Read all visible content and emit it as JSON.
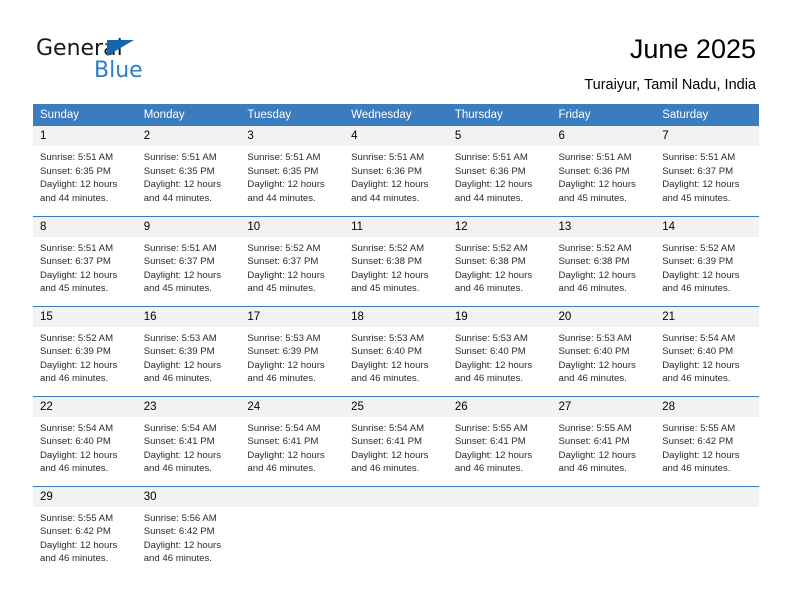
{
  "brand": {
    "name_top": "General",
    "name_bottom": "Blue",
    "triangle_color": "#1565b0",
    "text_color": "#1a1a1a",
    "blue_color": "#2a7fc9"
  },
  "header": {
    "title": "June 2025",
    "subtitle": "Turaiyur, Tamil Nadu, India"
  },
  "theme": {
    "header_bg": "#3a7cbe",
    "header_text": "#ffffff",
    "daynum_bg": "#f2f2f2",
    "row_divider": "#3a7cbe",
    "body_text": "#2b2b2b"
  },
  "columns": [
    "Sunday",
    "Monday",
    "Tuesday",
    "Wednesday",
    "Thursday",
    "Friday",
    "Saturday"
  ],
  "weeks": [
    [
      {
        "day": "1",
        "sunrise": "Sunrise: 5:51 AM",
        "sunset": "Sunset: 6:35 PM",
        "daylight1": "Daylight: 12 hours",
        "daylight2": "and 44 minutes."
      },
      {
        "day": "2",
        "sunrise": "Sunrise: 5:51 AM",
        "sunset": "Sunset: 6:35 PM",
        "daylight1": "Daylight: 12 hours",
        "daylight2": "and 44 minutes."
      },
      {
        "day": "3",
        "sunrise": "Sunrise: 5:51 AM",
        "sunset": "Sunset: 6:35 PM",
        "daylight1": "Daylight: 12 hours",
        "daylight2": "and 44 minutes."
      },
      {
        "day": "4",
        "sunrise": "Sunrise: 5:51 AM",
        "sunset": "Sunset: 6:36 PM",
        "daylight1": "Daylight: 12 hours",
        "daylight2": "and 44 minutes."
      },
      {
        "day": "5",
        "sunrise": "Sunrise: 5:51 AM",
        "sunset": "Sunset: 6:36 PM",
        "daylight1": "Daylight: 12 hours",
        "daylight2": "and 44 minutes."
      },
      {
        "day": "6",
        "sunrise": "Sunrise: 5:51 AM",
        "sunset": "Sunset: 6:36 PM",
        "daylight1": "Daylight: 12 hours",
        "daylight2": "and 45 minutes."
      },
      {
        "day": "7",
        "sunrise": "Sunrise: 5:51 AM",
        "sunset": "Sunset: 6:37 PM",
        "daylight1": "Daylight: 12 hours",
        "daylight2": "and 45 minutes."
      }
    ],
    [
      {
        "day": "8",
        "sunrise": "Sunrise: 5:51 AM",
        "sunset": "Sunset: 6:37 PM",
        "daylight1": "Daylight: 12 hours",
        "daylight2": "and 45 minutes."
      },
      {
        "day": "9",
        "sunrise": "Sunrise: 5:51 AM",
        "sunset": "Sunset: 6:37 PM",
        "daylight1": "Daylight: 12 hours",
        "daylight2": "and 45 minutes."
      },
      {
        "day": "10",
        "sunrise": "Sunrise: 5:52 AM",
        "sunset": "Sunset: 6:37 PM",
        "daylight1": "Daylight: 12 hours",
        "daylight2": "and 45 minutes."
      },
      {
        "day": "11",
        "sunrise": "Sunrise: 5:52 AM",
        "sunset": "Sunset: 6:38 PM",
        "daylight1": "Daylight: 12 hours",
        "daylight2": "and 45 minutes."
      },
      {
        "day": "12",
        "sunrise": "Sunrise: 5:52 AM",
        "sunset": "Sunset: 6:38 PM",
        "daylight1": "Daylight: 12 hours",
        "daylight2": "and 46 minutes."
      },
      {
        "day": "13",
        "sunrise": "Sunrise: 5:52 AM",
        "sunset": "Sunset: 6:38 PM",
        "daylight1": "Daylight: 12 hours",
        "daylight2": "and 46 minutes."
      },
      {
        "day": "14",
        "sunrise": "Sunrise: 5:52 AM",
        "sunset": "Sunset: 6:39 PM",
        "daylight1": "Daylight: 12 hours",
        "daylight2": "and 46 minutes."
      }
    ],
    [
      {
        "day": "15",
        "sunrise": "Sunrise: 5:52 AM",
        "sunset": "Sunset: 6:39 PM",
        "daylight1": "Daylight: 12 hours",
        "daylight2": "and 46 minutes."
      },
      {
        "day": "16",
        "sunrise": "Sunrise: 5:53 AM",
        "sunset": "Sunset: 6:39 PM",
        "daylight1": "Daylight: 12 hours",
        "daylight2": "and 46 minutes."
      },
      {
        "day": "17",
        "sunrise": "Sunrise: 5:53 AM",
        "sunset": "Sunset: 6:39 PM",
        "daylight1": "Daylight: 12 hours",
        "daylight2": "and 46 minutes."
      },
      {
        "day": "18",
        "sunrise": "Sunrise: 5:53 AM",
        "sunset": "Sunset: 6:40 PM",
        "daylight1": "Daylight: 12 hours",
        "daylight2": "and 46 minutes."
      },
      {
        "day": "19",
        "sunrise": "Sunrise: 5:53 AM",
        "sunset": "Sunset: 6:40 PM",
        "daylight1": "Daylight: 12 hours",
        "daylight2": "and 46 minutes."
      },
      {
        "day": "20",
        "sunrise": "Sunrise: 5:53 AM",
        "sunset": "Sunset: 6:40 PM",
        "daylight1": "Daylight: 12 hours",
        "daylight2": "and 46 minutes."
      },
      {
        "day": "21",
        "sunrise": "Sunrise: 5:54 AM",
        "sunset": "Sunset: 6:40 PM",
        "daylight1": "Daylight: 12 hours",
        "daylight2": "and 46 minutes."
      }
    ],
    [
      {
        "day": "22",
        "sunrise": "Sunrise: 5:54 AM",
        "sunset": "Sunset: 6:40 PM",
        "daylight1": "Daylight: 12 hours",
        "daylight2": "and 46 minutes."
      },
      {
        "day": "23",
        "sunrise": "Sunrise: 5:54 AM",
        "sunset": "Sunset: 6:41 PM",
        "daylight1": "Daylight: 12 hours",
        "daylight2": "and 46 minutes."
      },
      {
        "day": "24",
        "sunrise": "Sunrise: 5:54 AM",
        "sunset": "Sunset: 6:41 PM",
        "daylight1": "Daylight: 12 hours",
        "daylight2": "and 46 minutes."
      },
      {
        "day": "25",
        "sunrise": "Sunrise: 5:54 AM",
        "sunset": "Sunset: 6:41 PM",
        "daylight1": "Daylight: 12 hours",
        "daylight2": "and 46 minutes."
      },
      {
        "day": "26",
        "sunrise": "Sunrise: 5:55 AM",
        "sunset": "Sunset: 6:41 PM",
        "daylight1": "Daylight: 12 hours",
        "daylight2": "and 46 minutes."
      },
      {
        "day": "27",
        "sunrise": "Sunrise: 5:55 AM",
        "sunset": "Sunset: 6:41 PM",
        "daylight1": "Daylight: 12 hours",
        "daylight2": "and 46 minutes."
      },
      {
        "day": "28",
        "sunrise": "Sunrise: 5:55 AM",
        "sunset": "Sunset: 6:42 PM",
        "daylight1": "Daylight: 12 hours",
        "daylight2": "and 46 minutes."
      }
    ],
    [
      {
        "day": "29",
        "sunrise": "Sunrise: 5:55 AM",
        "sunset": "Sunset: 6:42 PM",
        "daylight1": "Daylight: 12 hours",
        "daylight2": "and 46 minutes."
      },
      {
        "day": "30",
        "sunrise": "Sunrise: 5:56 AM",
        "sunset": "Sunset: 6:42 PM",
        "daylight1": "Daylight: 12 hours",
        "daylight2": "and 46 minutes."
      },
      {
        "day": "",
        "sunrise": "",
        "sunset": "",
        "daylight1": "",
        "daylight2": ""
      },
      {
        "day": "",
        "sunrise": "",
        "sunset": "",
        "daylight1": "",
        "daylight2": ""
      },
      {
        "day": "",
        "sunrise": "",
        "sunset": "",
        "daylight1": "",
        "daylight2": ""
      },
      {
        "day": "",
        "sunrise": "",
        "sunset": "",
        "daylight1": "",
        "daylight2": ""
      },
      {
        "day": "",
        "sunrise": "",
        "sunset": "",
        "daylight1": "",
        "daylight2": ""
      }
    ]
  ]
}
